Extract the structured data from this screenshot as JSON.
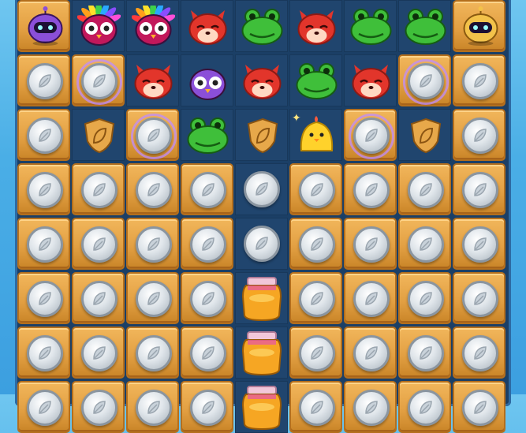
{
  "game": {
    "grid_rows": 8,
    "grid_cols": 9,
    "tiles": [
      [
        "robot-purple",
        "owl-rainbow",
        "owl-rainbow",
        "fox-red",
        "frog-green",
        "fox-red",
        "frog-green",
        "frog-green",
        "robot-gold"
      ],
      [
        "crate-coin",
        "crate-coin",
        "fox-red",
        "owl-purple",
        "fox-red",
        "frog-green",
        "fox-red",
        "crate-coin",
        "crate-coin"
      ],
      [
        "crate-coin",
        "shield-gold",
        "crate-coin",
        "frog-green",
        "shield-gold",
        "chick-yellow",
        "crate-coin",
        "shield-gold",
        "crate-coin"
      ],
      [
        "crate-coin",
        "crate-coin",
        "crate-coin",
        "crate-coin",
        "coin",
        "crate-coin",
        "crate-coin",
        "crate-coin",
        "crate-coin"
      ],
      [
        "crate-coin",
        "crate-coin",
        "crate-coin",
        "crate-coin",
        "coin",
        "crate-coin",
        "crate-coin",
        "crate-coin",
        "crate-coin"
      ],
      [
        "crate-coin",
        "crate-coin",
        "crate-coin",
        "crate-coin",
        "honey-jar",
        "crate-coin",
        "crate-coin",
        "crate-coin",
        "crate-coin"
      ],
      [
        "crate-coin",
        "crate-coin",
        "crate-coin",
        "crate-coin",
        "honey-jar",
        "crate-coin",
        "crate-coin",
        "crate-coin",
        "crate-coin"
      ],
      [
        "crate-coin",
        "crate-coin",
        "crate-coin",
        "crate-coin",
        "honey-jar",
        "crate-coin",
        "crate-coin",
        "crate-coin",
        "crate-coin"
      ]
    ]
  },
  "colors": {
    "board_bg": "#1b3f66",
    "crate": "#e3a043",
    "fox": "#e2352b",
    "frog": "#3fbf3a",
    "owl_purple": "#8b4fd8",
    "chick": "#ffd22b",
    "shield": "#e7a84a",
    "honey": "#f6a623"
  }
}
